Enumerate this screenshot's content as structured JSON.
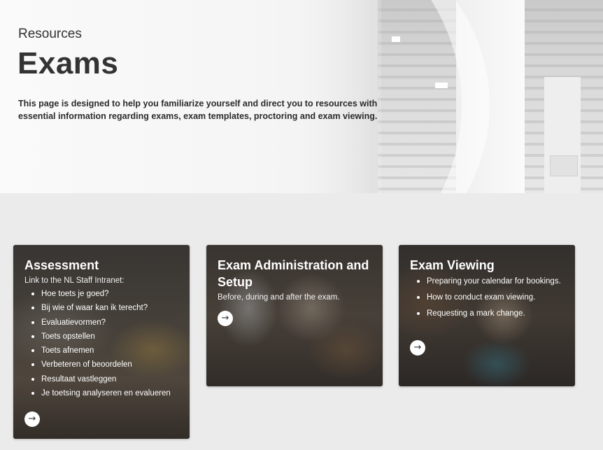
{
  "header": {
    "eyebrow": "Resources",
    "title": "Exams",
    "intro": "This page is designed to help you familiarize yourself and direct you to resources with essential information regarding exams, exam templates, proctoring and exam viewing."
  },
  "cards": [
    {
      "title": "Assessment",
      "description": "Link to the NL Staff Intranet:",
      "items": [
        "Hoe toets je goed?",
        "Bij wie of waar kan ik terecht?",
        "Evaluatievormen?",
        "Toets opstellen",
        "Toets afnemen",
        "Verbeteren of beoordelen",
        "Resultaat vastleggen",
        "Je toetsing analyseren en evalueren"
      ],
      "arrow_icon": "arrow-right-icon"
    },
    {
      "title": "Exam Administration and Setup",
      "description": "Before, during and after the exam.",
      "items": [],
      "arrow_icon": "arrow-right-icon"
    },
    {
      "title": "Exam Viewing",
      "description": "",
      "items": [
        "Preparing your calendar for bookings.",
        "How to conduct exam viewing.",
        "Requesting a mark change."
      ],
      "arrow_icon": "arrow-right-icon"
    }
  ],
  "icons": {
    "arrow": "→"
  }
}
